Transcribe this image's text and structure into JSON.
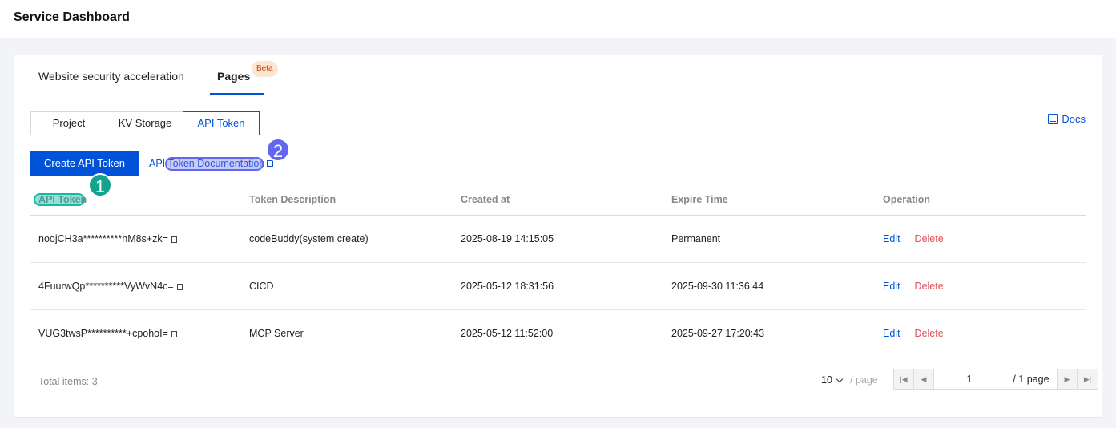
{
  "header": {
    "title": "Service Dashboard"
  },
  "tabs": [
    {
      "label": "Website security acceleration",
      "active": false
    },
    {
      "label": "Pages",
      "active": true,
      "badge": "Beta"
    }
  ],
  "segments": [
    {
      "label": "Project",
      "active": false
    },
    {
      "label": "KV Storage",
      "active": false
    },
    {
      "label": "API Token",
      "active": true
    }
  ],
  "docs_label": "Docs",
  "actions": {
    "create_label": "Create API Token",
    "doc_link_label": "API Token Documentation"
  },
  "annotations": {
    "marker1": "1",
    "marker2": "2"
  },
  "table": {
    "columns": [
      "API Token",
      "Token Description",
      "Created at",
      "Expire Time",
      "Operation"
    ],
    "rows": [
      {
        "token": "noojCH3a**********hM8s+zk=",
        "description": "codeBuddy(system create)",
        "created": "2025-08-19 14:15:05",
        "expire": "Permanent",
        "edit": "Edit",
        "delete": "Delete"
      },
      {
        "token": "4FuurwQp**********VyWvN4c=",
        "description": "CICD",
        "created": "2025-05-12 18:31:56",
        "expire": "2025-09-30 11:36:44",
        "edit": "Edit",
        "delete": "Delete"
      },
      {
        "token": "VUG3twsP**********+cpohoI=",
        "description": "MCP Server",
        "created": "2025-05-12 11:52:00",
        "expire": "2025-09-27 17:20:43",
        "edit": "Edit",
        "delete": "Delete"
      }
    ]
  },
  "footer": {
    "total_label": "Total items:",
    "total_count": "3",
    "page_size": "10",
    "page_size_unit": "/ page",
    "current_page": "1",
    "total_pages": "/ 1 page"
  },
  "colors": {
    "primary": "#0052d9",
    "danger": "#e34d59",
    "marker1": "#14a38e",
    "marker2": "#6366f1"
  }
}
